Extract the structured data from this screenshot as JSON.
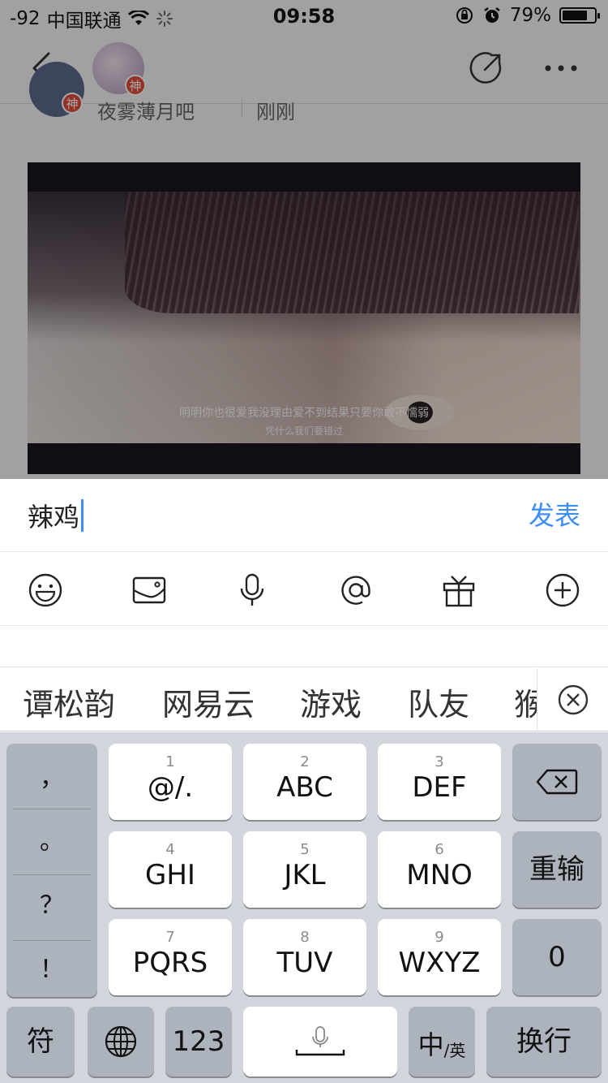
{
  "status_bar": {
    "signal": "-92",
    "carrier": "中国联通",
    "time": "09:58",
    "battery": "79%",
    "battery_level": 0.79
  },
  "nav": {
    "avatar_badge": "神"
  },
  "post": {
    "author_badge": "神",
    "author_name": "夜雾薄月吧",
    "time": "刚刚",
    "image_caption_line1": "明明你也很爱我没理由爱不到结果只要你敢不懦弱",
    "image_caption_line2": "凭什么我们要错过"
  },
  "composer": {
    "input_value": "辣鸡",
    "send_label": "发表"
  },
  "toolbar": {
    "icons": [
      "emoji-icon",
      "image-icon",
      "microphone-icon",
      "at-icon",
      "gift-icon",
      "plus-icon"
    ]
  },
  "candidates": [
    "谭松韵",
    "网易云",
    "游戏",
    "队友",
    "猴"
  ],
  "keyboard": {
    "punctuation": [
      "，",
      "。",
      "？",
      "！"
    ],
    "keys": [
      {
        "num": "1",
        "label": "@/."
      },
      {
        "num": "2",
        "label": "ABC"
      },
      {
        "num": "3",
        "label": "DEF"
      },
      {
        "num": "4",
        "label": "GHI"
      },
      {
        "num": "5",
        "label": "JKL"
      },
      {
        "num": "6",
        "label": "MNO"
      },
      {
        "num": "7",
        "label": "PQRS"
      },
      {
        "num": "8",
        "label": "TUV"
      },
      {
        "num": "9",
        "label": "WXYZ"
      }
    ],
    "retype_label": "重输",
    "zero_label": "0",
    "symbol_label": "符",
    "numbers_label": "123",
    "lang_main": "中",
    "lang_sub": "/英",
    "return_label": "换行"
  },
  "colors": {
    "accent": "#3e8ef7",
    "badge": "#e14b3c",
    "keyboard_bg": "#d2d5db",
    "key_dark": "#adb3bc"
  }
}
